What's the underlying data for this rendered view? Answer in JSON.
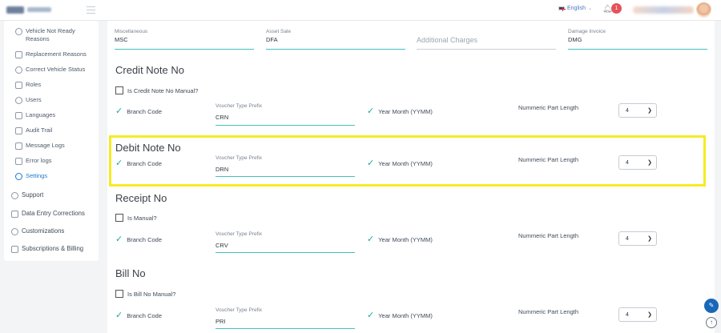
{
  "header": {
    "language": "English",
    "notification_count": "1"
  },
  "sidebar": {
    "items": [
      {
        "label": "Vehicle Not Ready Reasons",
        "icon": "pin-icon"
      },
      {
        "label": "Replacement Reasons",
        "icon": "edit-icon"
      },
      {
        "label": "Correct Vehicle Status",
        "icon": "refresh-icon"
      },
      {
        "label": "Roles",
        "icon": "id-card-icon"
      },
      {
        "label": "Users",
        "icon": "users-icon"
      },
      {
        "label": "Languages",
        "icon": "flag-icon"
      },
      {
        "label": "Audit Trail",
        "icon": "document-icon"
      },
      {
        "label": "Message Logs",
        "icon": "lock-icon"
      },
      {
        "label": "Error logs",
        "icon": "lock-icon"
      },
      {
        "label": "Settings",
        "icon": "gear-icon",
        "active": true
      }
    ],
    "top_items": [
      {
        "label": "Support",
        "icon": "support-icon"
      },
      {
        "label": "Data Entry Corrections",
        "icon": "edit-icon"
      },
      {
        "label": "Customizations",
        "icon": "plus-circle-icon"
      },
      {
        "label": "Subscriptions & Billing",
        "icon": "folder-icon"
      }
    ]
  },
  "top_fields": [
    {
      "label": "Miscellaneous",
      "value": "MSC"
    },
    {
      "label": "Asset Sale",
      "value": "DFA"
    },
    {
      "label": "",
      "placeholder": "Additional Charges",
      "value": ""
    },
    {
      "label": "Damage Invoice",
      "value": "DMG"
    }
  ],
  "sections": [
    {
      "title": "Credit Note No",
      "checkbox_label": "Is Credit Note No Manual?",
      "branch_code": "Branch Code",
      "prefix_label": "Voucher Type Prefix",
      "prefix_value": "CRN",
      "year_month": "Year Month (YYMM)",
      "numeric_label": "Nummeric Part Length",
      "numeric_value": "4"
    },
    {
      "title": "Debit Note No",
      "branch_code": "Branch Code",
      "prefix_label": "Voucher Type Prefix",
      "prefix_value": "DRN",
      "year_month": "Year Month (YYMM)",
      "numeric_label": "Nummeric Part Length",
      "numeric_value": "4"
    },
    {
      "title": "Receipt No",
      "checkbox_label": "Is Manual?",
      "branch_code": "Branch Code",
      "prefix_label": "Voucher Type Prefix",
      "prefix_value": "CRV",
      "year_month": "Year Month (YYMM)",
      "numeric_label": "Nummeric Part Length",
      "numeric_value": "4"
    },
    {
      "title": "Bill No",
      "checkbox_label": "Is Bill No Manual?",
      "branch_code": "Branch Code",
      "prefix_label": "Voucher Type Prefix",
      "prefix_value": "PRI",
      "year_month": "Year Month (YYMM)",
      "numeric_label": "Nummeric Part Length",
      "numeric_value": "4"
    }
  ],
  "colors": {
    "accent": "#45c1bf",
    "active_nav": "#1a7bd0",
    "highlight": "#f5ec23",
    "badge": "#e5525a"
  }
}
